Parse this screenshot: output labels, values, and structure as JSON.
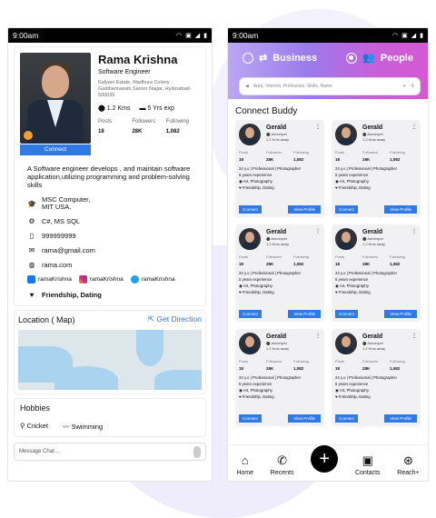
{
  "left": {
    "status_time": "9:00am",
    "profile": {
      "name": "Rama Krishna",
      "role": "Software Engineer",
      "address": "Kalyani Estate, Madhura Colony , Gaddiannaram,Saroor Nagar, Hyderabad-500035",
      "distance": "1.2 Kms",
      "experience": "5 Yrs exp",
      "stats_labels": [
        "Posts",
        "Followers",
        "Following"
      ],
      "stats_values": [
        "18",
        "28K",
        "1,082"
      ],
      "connect_label": "Connect"
    },
    "description": "A Software engineer develops , and maintain software application,utilizing programming and problem-solving skills",
    "education": "MSC Computer, MIT USA.",
    "skills": "C#, MS SQL",
    "phone": "999999999",
    "email": "rama@gmail.com",
    "website": "rama.com",
    "socials": [
      "ramaKrishna",
      "ramaKrishna",
      "ramaKrishna"
    ],
    "interest": "Friendship, Dating",
    "location_title": "Location ( Map)",
    "get_direction": "Get Direction",
    "hobbies_title": "Hobbies",
    "hobbies": [
      "Cricket",
      "Swimming"
    ],
    "chat_placeholder": "Message Chat...."
  },
  "right": {
    "status_time": "9:00am",
    "tabs": [
      "Business",
      "People"
    ],
    "search_placeholder": "Area, Interest, Profession, Skills, Name",
    "section_title": "Connect Buddy",
    "card": {
      "name": "Gerald",
      "location": "Ameerpet",
      "distance": "1.2 Kms away",
      "stats_labels": [
        "Posts",
        "Followers",
        "Following"
      ],
      "stats_values": [
        "18",
        "28K",
        "1,082"
      ],
      "line1": "24 y.o | Professional | Photographer",
      "line2": "5 years experience",
      "line3": "Art, Photography",
      "line4": "Friendship, Dating",
      "connect": "Connect",
      "view": "View Profile"
    },
    "nav": [
      "Home",
      "Recents",
      "Contacts",
      "Reach+"
    ]
  }
}
